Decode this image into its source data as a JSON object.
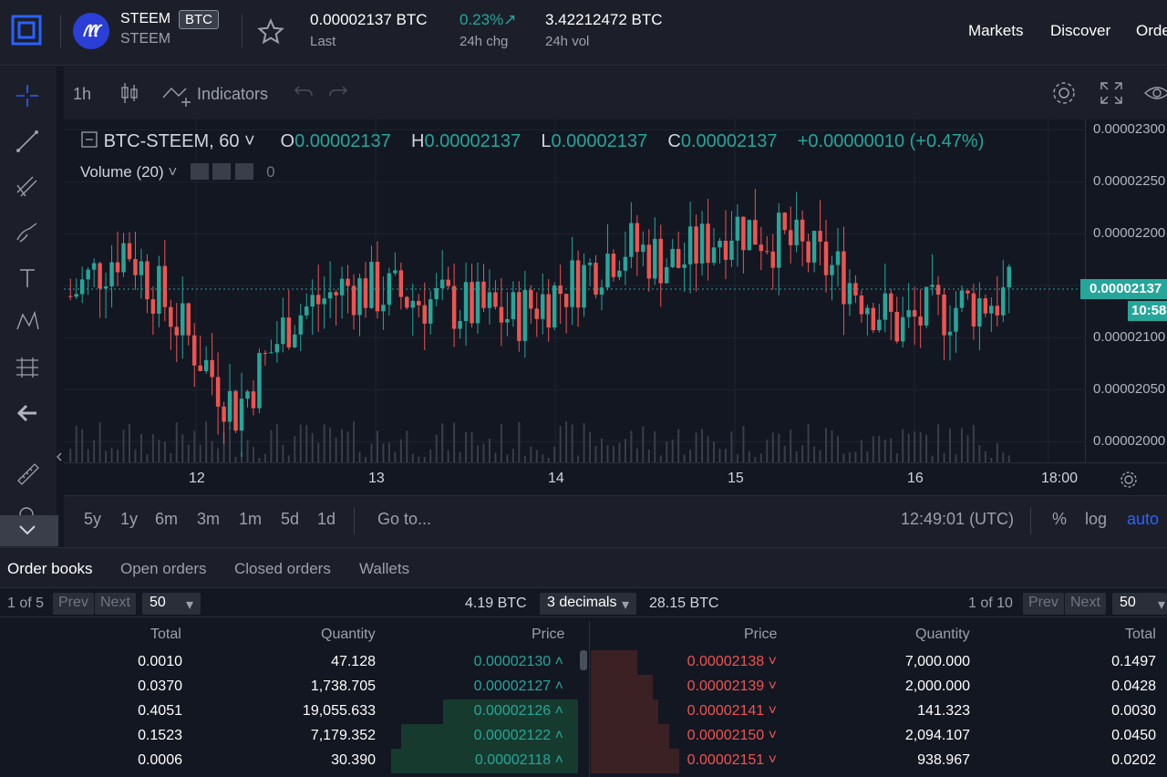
{
  "header": {
    "coin_name": "STEEM",
    "coin_badge": "BTC",
    "coin_sub": "STEEM",
    "last_value": "0.00002137 BTC",
    "last_label": "Last",
    "chg_value": "0.23%",
    "chg_arrow": "↗",
    "chg_label": "24h chg",
    "vol_value": "3.42212472 BTC",
    "vol_label": "24h vol",
    "nav": [
      "Markets",
      "Discover",
      "Orde"
    ]
  },
  "chart_toolbar": {
    "interval": "1h",
    "indicators": "Indicators"
  },
  "legend": {
    "symbol": "BTC-STEEM, 60",
    "o_label": "O",
    "o_value": "0.00002137",
    "h_label": "H",
    "h_value": "0.00002137",
    "l_label": "L",
    "l_value": "0.00002137",
    "c_label": "C",
    "c_value": "0.00002137",
    "change": "+0.00000010 (+0.47%)",
    "volume_label": "Volume (20)",
    "volume_value": "0"
  },
  "price_axis": {
    "ticks": [
      "0.00002300",
      "0.00002250",
      "0.00002200",
      "0.00002150",
      "0.00002100",
      "0.00002050",
      "0.00002000"
    ],
    "current_price": "0.00002137",
    "countdown": "10:58"
  },
  "time_axis": {
    "ticks": [
      "12",
      "13",
      "14",
      "15",
      "16",
      "18:00"
    ]
  },
  "range_bar": {
    "ranges": [
      "5y",
      "1y",
      "6m",
      "3m",
      "1m",
      "5d",
      "1d"
    ],
    "goto": "Go to...",
    "clock": "12:49:01 (UTC)",
    "percent": "%",
    "log": "log",
    "auto": "auto"
  },
  "colors": {
    "up": "#26a69a",
    "down": "#ef5350",
    "accent": "#2962ff"
  },
  "chart_data": {
    "type": "candlestick",
    "title": "BTC-STEEM, 60",
    "ylim": [
      1.98e-05,
      2.31e-05
    ],
    "candles": [
      [
        2.14e-05,
        2.16e-05,
        2.12e-05,
        2.14e-05
      ],
      [
        2.22e-05,
        2.25e-05,
        2.17e-05,
        2.19e-05
      ],
      [
        2.19e-05,
        2.24e-05,
        2.14e-05,
        2.11e-05
      ],
      [
        2.1e-05,
        2.13e-05,
        2.02e-05,
        2.03e-05
      ],
      [
        2.04e-05,
        2.14e-05,
        2.04e-05,
        2.12e-05
      ],
      [
        2.12e-05,
        2.16e-05,
        2.09e-05,
        2.15e-05
      ],
      [
        2.15e-05,
        2.18e-05,
        2.13e-05,
        2.14e-05
      ],
      [
        2.14e-05,
        2.16e-05,
        2.01e-05,
        2.13e-05
      ],
      [
        2.13e-05,
        2.17e-05,
        2.05e-05,
        2.12e-05
      ],
      [
        2.12e-05,
        2.16e-05,
        2.09e-05,
        2.15e-05
      ],
      [
        2.15e-05,
        2.2e-05,
        2.14e-05,
        2.19e-05
      ],
      [
        2.19e-05,
        2.21e-05,
        2.16e-05,
        2.17e-05
      ],
      [
        2.17e-05,
        2.22e-05,
        2.15e-05,
        2.21e-05
      ],
      [
        2.21e-05,
        2.22e-05,
        2.17e-05,
        2.19e-05
      ],
      [
        2.19e-05,
        2.23e-05,
        2.14e-05,
        2.16e-05
      ],
      [
        2.16e-05,
        2.18e-05,
        2.1e-05,
        2.11e-05
      ],
      [
        2.11e-05,
        2.15e-05,
        2.09e-05,
        2.13e-05
      ],
      [
        2.13e-05,
        2.15e-05,
        2.12e-05,
        2.14e-05
      ]
    ],
    "series": [
      {
        "name": "Volume (20)",
        "values": [
          0
        ]
      }
    ]
  },
  "bottom_tabs": [
    "Order books",
    "Open orders",
    "Closed orders",
    "Wallets"
  ],
  "orderbook": {
    "left_page": "1 of 5",
    "right_page": "1 of 10",
    "prev": "Prev",
    "next": "Next",
    "page_size": "50",
    "bid_total": "4.19 BTC",
    "decimals": "3 decimals",
    "ask_total": "28.15 BTC",
    "bid_headers": [
      "Total",
      "Quantity",
      "Price"
    ],
    "ask_headers": [
      "Price",
      "Quantity",
      "Total"
    ],
    "bids": [
      {
        "total": "0.0010",
        "quantity": "47.128",
        "price": "0.00002130",
        "depth": 0.0
      },
      {
        "total": "0.0370",
        "quantity": "1,738.705",
        "price": "0.00002127",
        "depth": 0.0
      },
      {
        "total": "0.4051",
        "quantity": "19,055.633",
        "price": "0.00002126",
        "depth": 0.26
      },
      {
        "total": "0.1523",
        "quantity": "7,179.352",
        "price": "0.00002122",
        "depth": 0.34
      },
      {
        "total": "0.0006",
        "quantity": "30.390",
        "price": "0.00002118",
        "depth": 0.36
      }
    ],
    "asks": [
      {
        "price": "0.00002138",
        "quantity": "7,000.000",
        "total": "0.1497",
        "depth": 0.09
      },
      {
        "price": "0.00002139",
        "quantity": "2,000.000",
        "total": "0.0428",
        "depth": 0.12
      },
      {
        "price": "0.00002141",
        "quantity": "141.323",
        "total": "0.0030",
        "depth": 0.13
      },
      {
        "price": "0.00002150",
        "quantity": "2,094.107",
        "total": "0.0450",
        "depth": 0.15
      },
      {
        "price": "0.00002151",
        "quantity": "938.967",
        "total": "0.0202",
        "depth": 0.17
      }
    ]
  }
}
